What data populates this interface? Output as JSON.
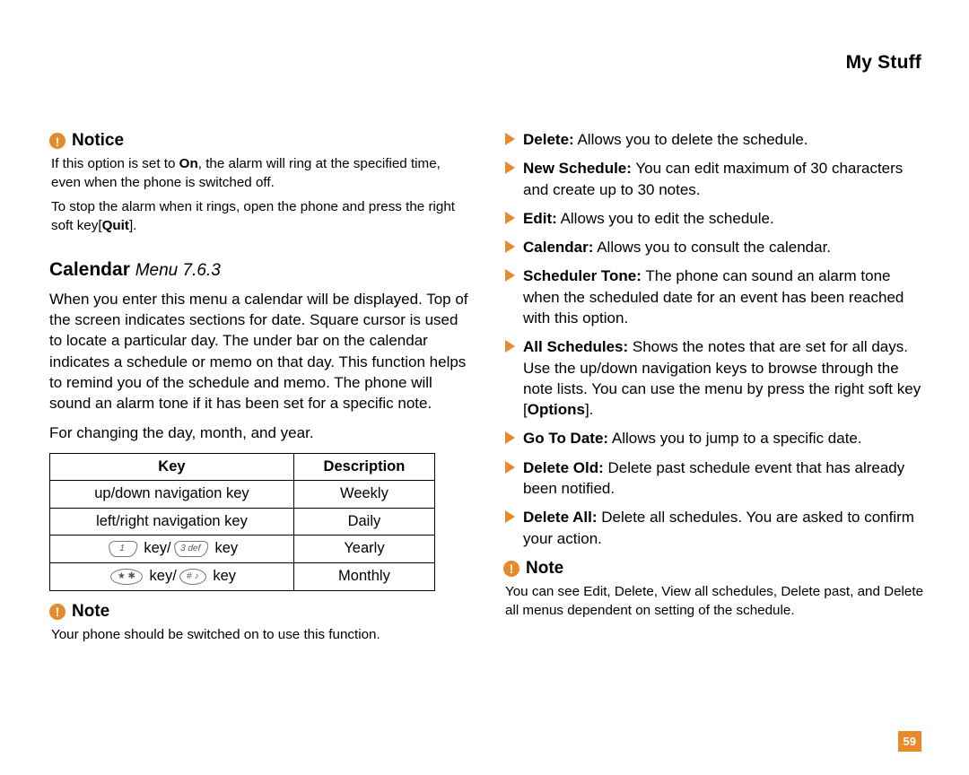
{
  "header": {
    "title": "My Stuff"
  },
  "left": {
    "notice": {
      "label": "Notice",
      "p1_a": "If this option is set to ",
      "p1_b": "On",
      "p1_c": ", the alarm will ring at the specified time, even when the phone is switched off.",
      "p2_a": "To stop the alarm when it rings, open the phone and press the right soft key[",
      "p2_b": "Quit",
      "p2_c": "]."
    },
    "calendar": {
      "title": "Calendar",
      "menu": "Menu 7.6.3",
      "p1": "When you enter this menu a calendar will be displayed. Top of the screen indicates sections for date. Square cursor is used to locate a particular day. The under bar on the calendar indicates a schedule or memo on that day. This function helps to remind you of the schedule and memo. The phone will sound an alarm tone if it has been set for a specific note.",
      "p2": "For changing the day, month, and year."
    },
    "table": {
      "h1": "Key",
      "h2": "Description",
      "rows": [
        {
          "key_text": "up/down navigation key",
          "desc": "Weekly"
        },
        {
          "key_text": "left/right navigation key",
          "desc": "Daily"
        },
        {
          "key_text_suffix": " key/",
          "key_text_suffix2": " key",
          "desc": "Yearly",
          "cap1": "1",
          "cap2": "3 def"
        },
        {
          "key_text_suffix": " key/",
          "key_text_suffix2": " key",
          "desc": "Monthly",
          "cap1": "★ ✱",
          "cap2": "# ♪"
        }
      ]
    },
    "note1": {
      "label": "Note",
      "body": "Your phone should be switched on to use this function."
    }
  },
  "right": {
    "items": [
      {
        "term": "Delete:",
        "text": " Allows you to delete the schedule."
      },
      {
        "term": "New Schedule:",
        "text": " You can edit maximum of 30 characters and create up to 30 notes."
      },
      {
        "term": "Edit:",
        "text": " Allows you to edit the schedule."
      },
      {
        "term": "Calendar:",
        "text": " Allows you to consult the calendar."
      },
      {
        "term": "Scheduler Tone:",
        "text": " The phone can sound an alarm tone when the scheduled date for an event has been reached with this option."
      },
      {
        "term": "All Schedules:",
        "text_a": " Shows the notes that are set for all days. Use the up/down navigation keys to browse through the note lists. You can use the menu by press the right soft key [",
        "text_b": "Options",
        "text_c": "]."
      },
      {
        "term": "Go To Date:",
        "text": " Allows you to jump to a specific date."
      },
      {
        "term": "Delete Old:",
        "text": " Delete past schedule event that has already been notified."
      },
      {
        "term": "Delete All:",
        "text": " Delete all schedules. You are asked to confirm your action."
      }
    ],
    "note": {
      "label": "Note",
      "body": "You can see Edit, Delete, View all schedules, Delete past, and Delete all menus dependent on setting of the schedule."
    }
  },
  "page_number": "59"
}
